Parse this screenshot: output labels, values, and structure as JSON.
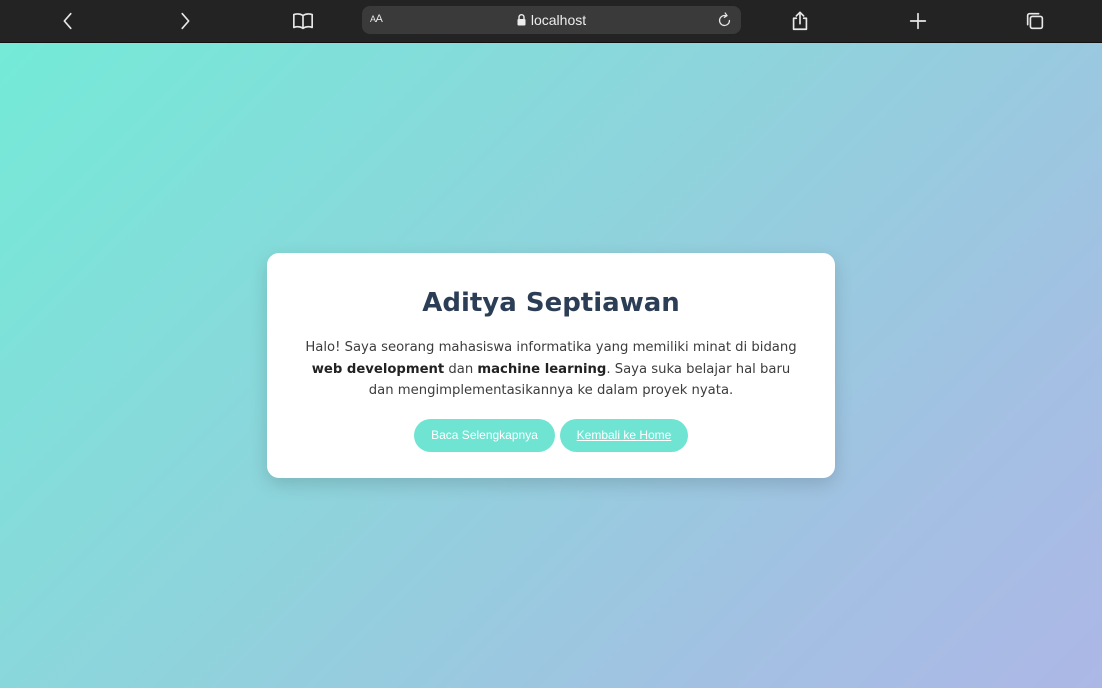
{
  "browser": {
    "url": "localhost",
    "reader_label_small": "A",
    "reader_label_large": "A"
  },
  "card": {
    "title": "Aditya Septiawan",
    "bio": {
      "part1": "Halo! Saya seorang mahasiswa informatika yang memiliki minat di bidang ",
      "bold1": "web development",
      "part2": " dan ",
      "bold2": "machine learning",
      "part3": ". Saya suka belajar hal baru dan mengimplementasikannya ke dalam proyek nyata."
    },
    "buttons": {
      "read_more": "Baca Selengkapnya",
      "back_home": "Kembali ke Home"
    }
  },
  "colors": {
    "gradient_start": "#74ead7",
    "gradient_end": "#acb7e6",
    "button_bg": "#6fe4d2",
    "title": "#2c3e56"
  }
}
